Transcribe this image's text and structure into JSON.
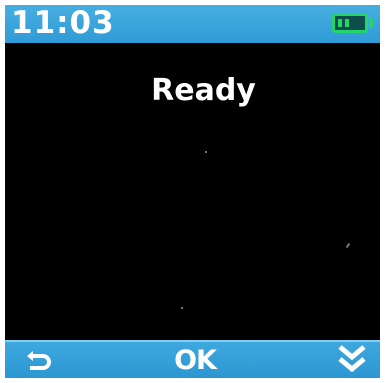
{
  "status_bar": {
    "time": "11:03",
    "battery_icon": "battery-icon",
    "battery_color": "#22d46a"
  },
  "main": {
    "status_text": "Ready"
  },
  "softkeys": {
    "left_icon": "back-arrow-icon",
    "center_label": "OK",
    "right_icon": "double-chevron-down-icon"
  },
  "colors": {
    "bar": "#3ea8de",
    "screen": "#000000",
    "text": "#ffffff"
  }
}
